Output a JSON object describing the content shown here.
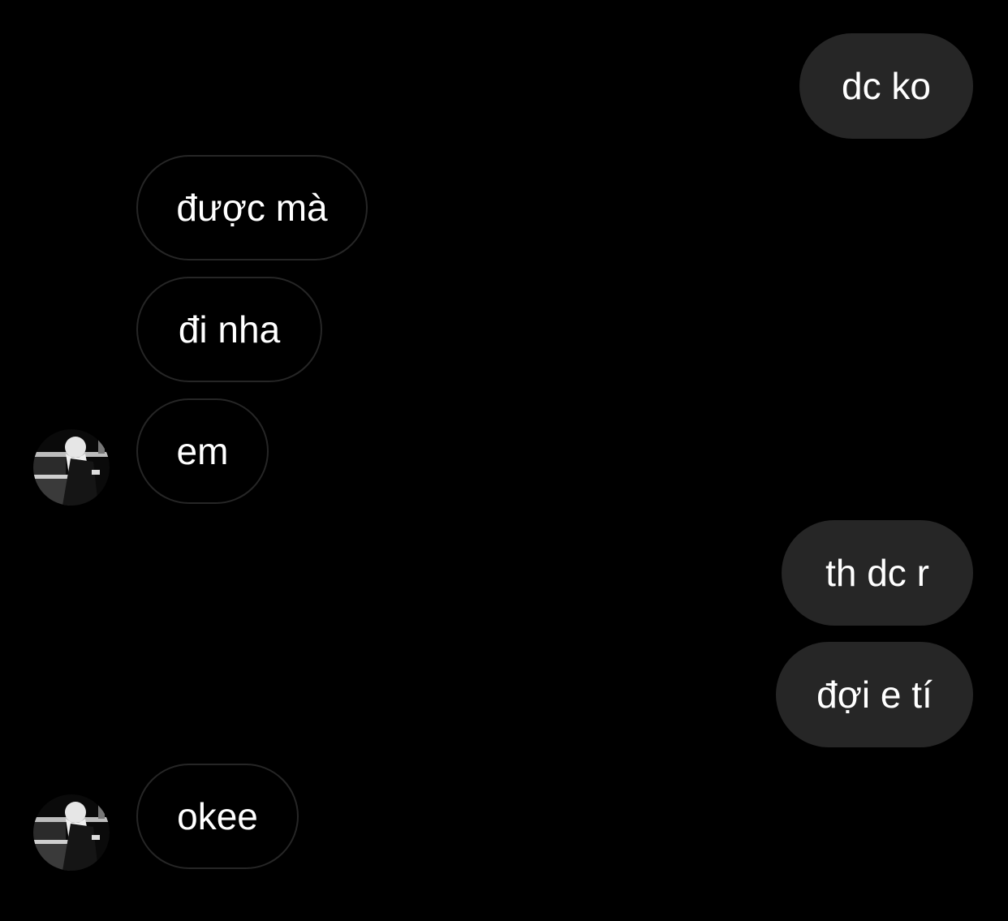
{
  "colors": {
    "background": "#000000",
    "outgoing_bubble": "#262626",
    "incoming_border": "#262626",
    "text": "#ffffff"
  },
  "messages": [
    {
      "direction": "outgoing",
      "text": "dc ko"
    },
    {
      "direction": "incoming",
      "text": "được mà"
    },
    {
      "direction": "incoming",
      "text": "đi nha"
    },
    {
      "direction": "incoming",
      "text": "em",
      "avatar": "contact-avatar-icon"
    },
    {
      "direction": "outgoing",
      "text": "th dc r"
    },
    {
      "direction": "outgoing",
      "text": "đợi e tí"
    },
    {
      "direction": "incoming",
      "text": "okee",
      "avatar": "contact-avatar-icon"
    }
  ]
}
